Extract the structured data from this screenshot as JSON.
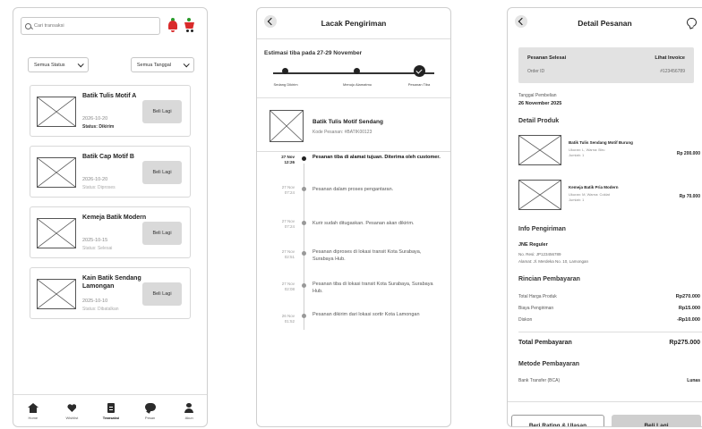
{
  "transactions": {
    "search_placeholder": "Cari transaksi",
    "filter_status": "Semua Status",
    "filter_date": "Semua Tanggal",
    "orders": [
      {
        "name": "Batik Tulis Motif A",
        "date": "2026-10-20",
        "status": "Status: Dikirim",
        "button": "Beli Lagi"
      },
      {
        "name": "Batik Cap Motif B",
        "date": "2026-10-20",
        "status": "Status: Diproses",
        "button": "Beli Lagi"
      },
      {
        "name": "Kemeja Batik Modern",
        "date": "2025-10-15",
        "status": "Status: Selesai",
        "button": "Beli Lagi"
      },
      {
        "name": "Kain Batik Sendang Lamongan",
        "date": "2025-10-10",
        "status": "Status: Dibatalkan",
        "button": "Beli Lagi"
      }
    ],
    "nav": [
      "Home",
      "Wishlist",
      "Transaksi",
      "Pesan",
      "Akun"
    ]
  },
  "tracking": {
    "title": "Lacak Pengiriman",
    "estimate": "Estimasi tiba pada 27-29 November",
    "steps": [
      "Sedang Dikirim",
      "Menuju Alamatmu",
      "Pesanan Tiba"
    ],
    "product_name": "Batik Tulis Motif Sendang",
    "product_code": "Kode Pesanan: #BATIK00123",
    "events": [
      {
        "date": "27 Nov",
        "time": "12:26",
        "text": "Pesanan tiba di alamat tujuan. Diterima oleh customer."
      },
      {
        "date": "27 Nov",
        "time": "07:24",
        "text": "Pesanan dalam proses pengantaran."
      },
      {
        "date": "27 Nov",
        "time": "07:24",
        "text": "Kurir sudah ditugaskan. Pesanan akan dikirim."
      },
      {
        "date": "27 Nov",
        "time": "02:51",
        "text": "Pesanan diproses di lokasi transit Kota Surabaya, Surabaya Hub."
      },
      {
        "date": "27 Nov",
        "time": "02:08",
        "text": "Pesanan tiba di lokasi transit Kota Surabaya, Surabaya Hub."
      },
      {
        "date": "26 Nov",
        "time": "01:52",
        "text": "Pesanan dikirim dari lokasi sortir Kota Lamongan"
      }
    ]
  },
  "detail": {
    "title": "Detail Pesanan",
    "status_title": "Pesanan Selesai",
    "invoice_link": "Lihat Invoice",
    "order_id_label": "Order ID",
    "order_id": "#123456789",
    "date_label": "Tanggal Pembelian",
    "date_value": "26 November 2025",
    "products_title": "Detail Produk",
    "products": [
      {
        "name": "Batik Tulis Sendang Motif Burung",
        "variant": "Ukuran: L, Warna: Biru",
        "qty": "Jumlah: 1",
        "price": "Rp 200.000"
      },
      {
        "name": "Kemeja Batik Pria Modern",
        "variant": "Ukuran: M, Warna: Coklat",
        "qty": "Jumlah: 1",
        "price": "Rp 70.000"
      }
    ],
    "shipping_title": "Info Pengiriman",
    "courier": "JNE Reguler",
    "resi": "No. Resi: JP123456789",
    "address": "Alamat: Jl. Merdeka No. 10, Lamongan",
    "payment_title": "Rincian Pembayaran",
    "rows": [
      {
        "label": "Total Harga Produk",
        "value": "Rp270.000"
      },
      {
        "label": "Biaya Pengiriman",
        "value": "Rp15.000"
      },
      {
        "label": "Diskon",
        "value": "-Rp10.000"
      }
    ],
    "total_label": "Total Pembayaran",
    "total_value": "Rp275.000",
    "method_title": "Metode Pembayaran",
    "method_label": "Bank Transfer (BCA)",
    "method_value": "Lunas",
    "rate_button": "Beri Rating & Ulasan",
    "buy_button": "Beli Lagi"
  }
}
